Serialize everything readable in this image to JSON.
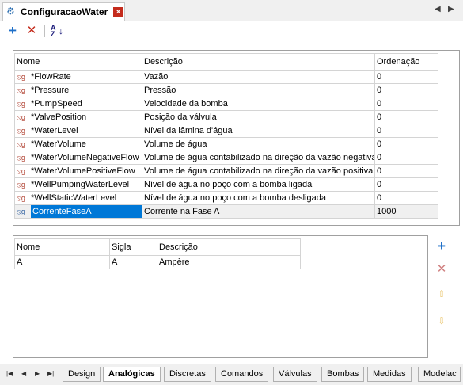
{
  "window": {
    "title": "ConfiguracaoWater"
  },
  "toolbar": {
    "add": "+",
    "remove": "✕",
    "sort_top": "A",
    "sort_bottom": "Z"
  },
  "top_grid": {
    "headers": [
      "Nome",
      "Descrição",
      "Ordenação"
    ],
    "rows": [
      {
        "nome": "*FlowRate",
        "descricao": "Vazão",
        "ordenacao": "0"
      },
      {
        "nome": "*Pressure",
        "descricao": "Pressão",
        "ordenacao": "0"
      },
      {
        "nome": "*PumpSpeed",
        "descricao": "Velocidade da bomba",
        "ordenacao": "0"
      },
      {
        "nome": "*ValvePosition",
        "descricao": "Posição da válvula",
        "ordenacao": "0"
      },
      {
        "nome": "*WaterLevel",
        "descricao": "Nível da lâmina d'água",
        "ordenacao": "0"
      },
      {
        "nome": "*WaterVolume",
        "descricao": "Volume de água",
        "ordenacao": "0"
      },
      {
        "nome": "*WaterVolumeNegativeFlow",
        "descricao": "Volume de água contabilizado na direção da vazão negativa",
        "ordenacao": "0"
      },
      {
        "nome": "*WaterVolumePositiveFlow",
        "descricao": "Volume de água contabilizado na direção da vazão positiva",
        "ordenacao": "0"
      },
      {
        "nome": "*WellPumpingWaterLevel",
        "descricao": "Nível de água no poço com a bomba ligada",
        "ordenacao": "0"
      },
      {
        "nome": "*WellStaticWaterLevel",
        "descricao": "Nível de água no poço com a bomba desligada",
        "ordenacao": "0"
      },
      {
        "nome": "CorrenteFaseA",
        "descricao": "Corrente na Fase A",
        "ordenacao": "1000"
      }
    ]
  },
  "bottom_grid": {
    "headers": [
      "Nome",
      "Sigla",
      "Descrição"
    ],
    "rows": [
      {
        "nome": "A",
        "sigla": "A",
        "descricao": "Ampère"
      }
    ]
  },
  "bottom_tabs": [
    "Design",
    "Analógicas",
    "Discretas",
    "Comandos",
    "Válvulas",
    "Bombas",
    "Medidas",
    "Modelac"
  ],
  "active_tab": "Analógicas",
  "colors": {
    "selection": "#0078d7",
    "accent_blue": "#1e6fc8",
    "delete_red": "#c42b1c"
  }
}
